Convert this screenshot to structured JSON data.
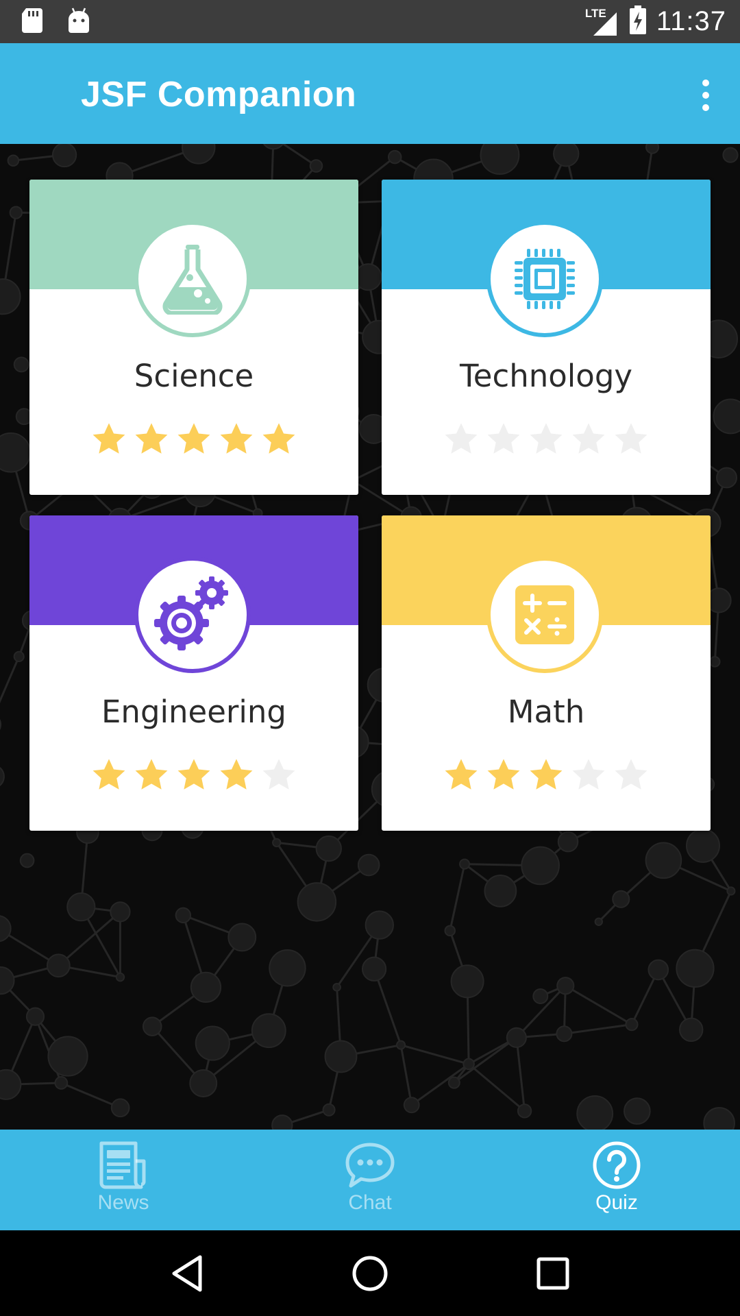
{
  "status_bar": {
    "time": "11:37",
    "network": "LTE",
    "icons": [
      "sd-card-icon",
      "android-icon",
      "lte-signal-icon",
      "battery-charging-icon"
    ]
  },
  "app_bar": {
    "title": "JSF Companion",
    "menu_icon": "overflow-menu-icon"
  },
  "quiz_categories": [
    {
      "label": "Science",
      "icon": "flask-icon",
      "color": "#9fd8c0",
      "stars_filled": 5,
      "stars_total": 5
    },
    {
      "label": "Technology",
      "icon": "chip-icon",
      "color": "#3db8e4",
      "stars_filled": 0,
      "stars_total": 5
    },
    {
      "label": "Engineering",
      "icon": "gears-icon",
      "color": "#6f45d8",
      "stars_filled": 4,
      "stars_total": 5
    },
    {
      "label": "Math",
      "icon": "calculator-icon",
      "color": "#fbd35c",
      "stars_filled": 3,
      "stars_total": 5
    }
  ],
  "colors": {
    "primary": "#3db8e4",
    "star_filled": "#fcce58",
    "star_empty": "#efefef"
  },
  "bottom_nav": {
    "items": [
      {
        "label": "News",
        "icon": "newspaper-icon",
        "active": false
      },
      {
        "label": "Chat",
        "icon": "chat-bubble-icon",
        "active": false
      },
      {
        "label": "Quiz",
        "icon": "question-circle-icon",
        "active": true
      }
    ]
  },
  "system_nav": {
    "icons": [
      "back-icon",
      "home-icon",
      "recents-icon"
    ]
  }
}
